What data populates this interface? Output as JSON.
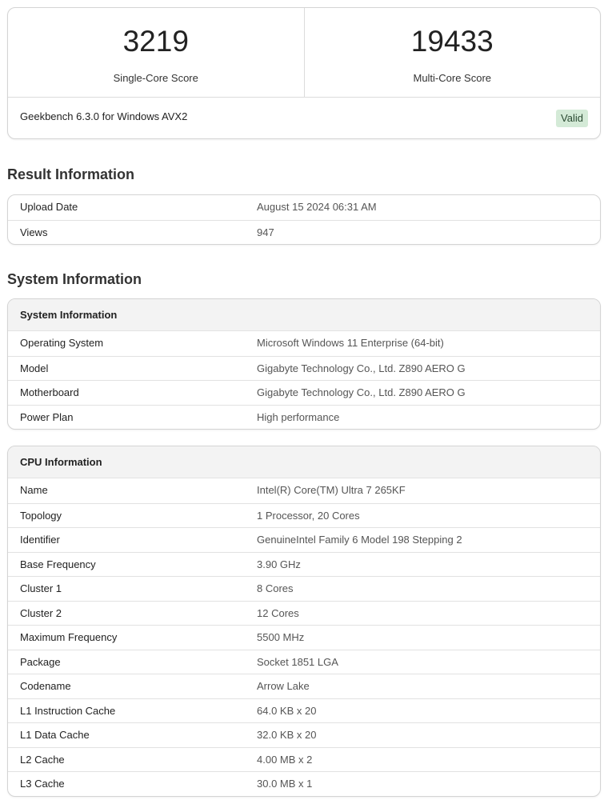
{
  "scores": {
    "single": {
      "value": "3219",
      "label": "Single-Core Score"
    },
    "multi": {
      "value": "19433",
      "label": "Multi-Core Score"
    },
    "version": "Geekbench 6.3.0 for Windows AVX2",
    "badge": "Valid"
  },
  "result_section": {
    "heading": "Result Information",
    "rows": [
      {
        "key": "Upload Date",
        "value": "August 15 2024 06:31 AM"
      },
      {
        "key": "Views",
        "value": "947"
      }
    ]
  },
  "system_section": {
    "heading": "System Information",
    "system_card": {
      "title": "System Information",
      "rows": [
        {
          "key": "Operating System",
          "value": "Microsoft Windows 11 Enterprise (64-bit)"
        },
        {
          "key": "Model",
          "value": "Gigabyte Technology Co., Ltd. Z890 AERO G"
        },
        {
          "key": "Motherboard",
          "value": "Gigabyte Technology Co., Ltd. Z890 AERO G"
        },
        {
          "key": "Power Plan",
          "value": "High performance"
        }
      ]
    },
    "cpu_card": {
      "title": "CPU Information",
      "rows": [
        {
          "key": "Name",
          "value": "Intel(R) Core(TM) Ultra 7 265KF"
        },
        {
          "key": "Topology",
          "value": "1 Processor, 20 Cores"
        },
        {
          "key": "Identifier",
          "value": "GenuineIntel Family 6 Model 198 Stepping 2"
        },
        {
          "key": "Base Frequency",
          "value": "3.90 GHz"
        },
        {
          "key": "Cluster 1",
          "value": "8 Cores"
        },
        {
          "key": "Cluster 2",
          "value": "12 Cores"
        },
        {
          "key": "Maximum Frequency",
          "value": "5500 MHz"
        },
        {
          "key": "Package",
          "value": "Socket 1851 LGA"
        },
        {
          "key": "Codename",
          "value": "Arrow Lake"
        },
        {
          "key": "L1 Instruction Cache",
          "value": "64.0 KB x 20"
        },
        {
          "key": "L1 Data Cache",
          "value": "32.0 KB x 20"
        },
        {
          "key": "L2 Cache",
          "value": "4.00 MB x 2"
        },
        {
          "key": "L3 Cache",
          "value": "30.0 MB x 1"
        }
      ]
    }
  },
  "colors": {
    "valid_badge_bg": "#d4ead7",
    "header_bg": "#f3f3f3",
    "border": "#d4d4d4"
  }
}
